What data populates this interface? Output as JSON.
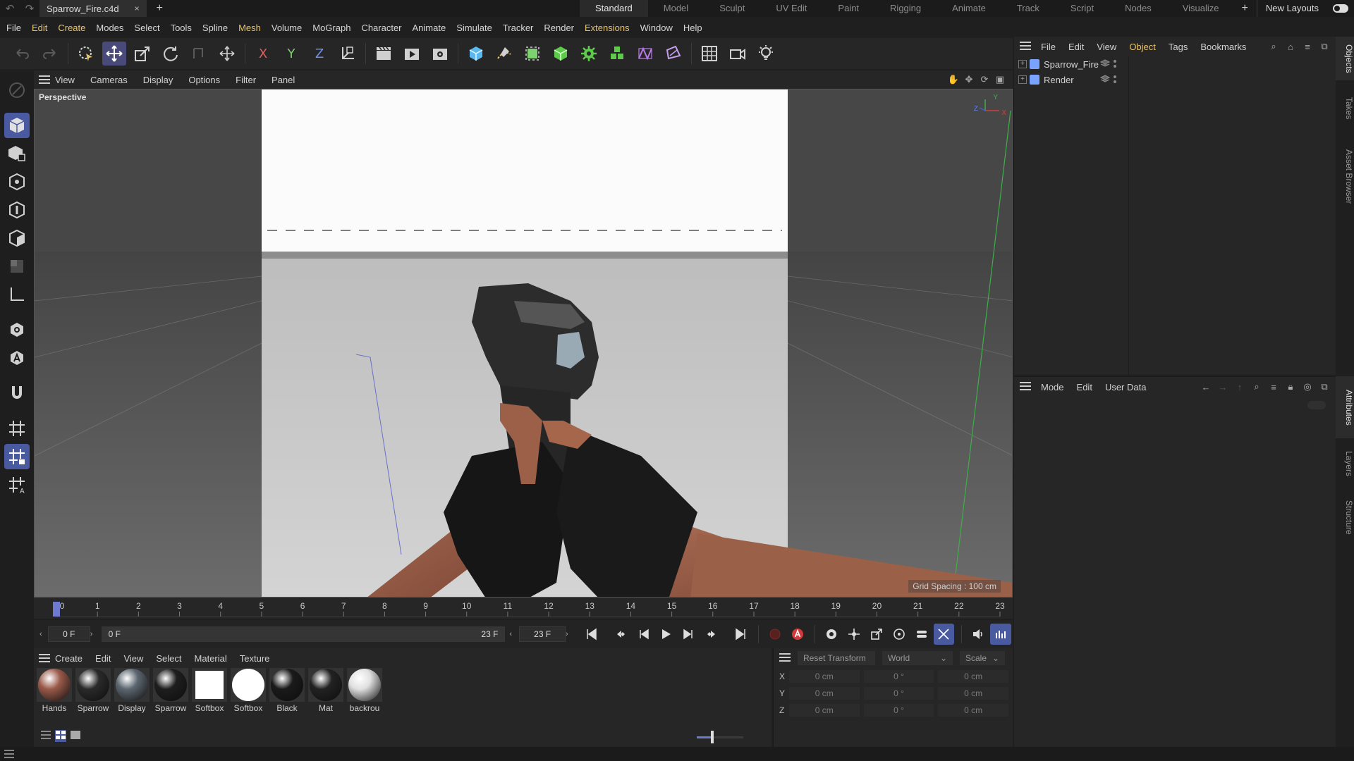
{
  "title_bar": {
    "document_tab": "Sparrow_Fire.c4d",
    "close_glyph": "×",
    "add_glyph": "+",
    "layouts": [
      "Standard",
      "Model",
      "Sculpt",
      "UV Edit",
      "Paint",
      "Rigging",
      "Animate",
      "Track",
      "Script",
      "Nodes",
      "Visualize"
    ],
    "new_layouts": "New Layouts"
  },
  "menubar": {
    "items": [
      "File",
      "Edit",
      "Create",
      "Modes",
      "Select",
      "Tools",
      "Spline",
      "Mesh",
      "Volume",
      "MoGraph",
      "Character",
      "Animate",
      "Simulate",
      "Tracker",
      "Render",
      "Extensions",
      "Window",
      "Help"
    ],
    "highlight": [
      "Edit",
      "Create",
      "Mesh",
      "Extensions"
    ]
  },
  "toolbar": {
    "axis_x": "X",
    "axis_y": "Y",
    "axis_z": "Z"
  },
  "viewport": {
    "menu": [
      "View",
      "Cameras",
      "Display",
      "Options",
      "Filter",
      "Panel"
    ],
    "label": "Perspective",
    "grid_spacing": "Grid Spacing : 100 cm",
    "gizmo": {
      "x": "X",
      "y": "Y",
      "z": "Z"
    }
  },
  "timeline": {
    "ticks": [
      "0",
      "1",
      "2",
      "3",
      "4",
      "5",
      "6",
      "7",
      "8",
      "9",
      "10",
      "11",
      "12",
      "13",
      "14",
      "15",
      "16",
      "17",
      "18",
      "19",
      "20",
      "21",
      "22",
      "23"
    ],
    "current_frame": "0 F",
    "range_start": "0 F",
    "range_end_inner": "23 F",
    "range_end": "23 F"
  },
  "materials": {
    "menu": [
      "Create",
      "Edit",
      "View",
      "Select",
      "Material",
      "Texture"
    ],
    "items": [
      {
        "name": "Hands",
        "color": "#9a5a4a"
      },
      {
        "name": "Sparrow",
        "color": "#2a2a2a"
      },
      {
        "name": "Display",
        "color": "#5c6670"
      },
      {
        "name": "Sparrow",
        "color": "#1e1e1e"
      },
      {
        "name": "Softbox",
        "color": "#ffffff"
      },
      {
        "name": "Softbox",
        "color": "#ffffff"
      },
      {
        "name": "Black",
        "color": "#1a1a1a"
      },
      {
        "name": "Mat",
        "color": "#222222"
      },
      {
        "name": "backrou",
        "color": "#e0e0e0"
      }
    ],
    "zoom_slider_fraction": 0.33
  },
  "coordinates": {
    "reset": "Reset Transform",
    "space": "World",
    "mode": "Scale",
    "rows": [
      {
        "axis": "X",
        "pos": "0 cm",
        "rot": "0 °",
        "scale": "0 cm"
      },
      {
        "axis": "Y",
        "pos": "0 cm",
        "rot": "0 °",
        "scale": "0 cm"
      },
      {
        "axis": "Z",
        "pos": "0 cm",
        "rot": "0 °",
        "scale": "0 cm"
      }
    ]
  },
  "objects_panel": {
    "menu": [
      "File",
      "Edit",
      "View",
      "Object",
      "Tags",
      "Bookmarks"
    ],
    "active_menu": "Object",
    "objects": [
      {
        "name": "Sparrow_Fire"
      },
      {
        "name": "Render"
      }
    ]
  },
  "attributes_panel": {
    "menu": [
      "Mode",
      "Edit",
      "User Data"
    ]
  },
  "side_tabs": [
    "Objects",
    "Takes",
    "Asset Browser",
    "Attributes",
    "Layers",
    "Structure"
  ]
}
